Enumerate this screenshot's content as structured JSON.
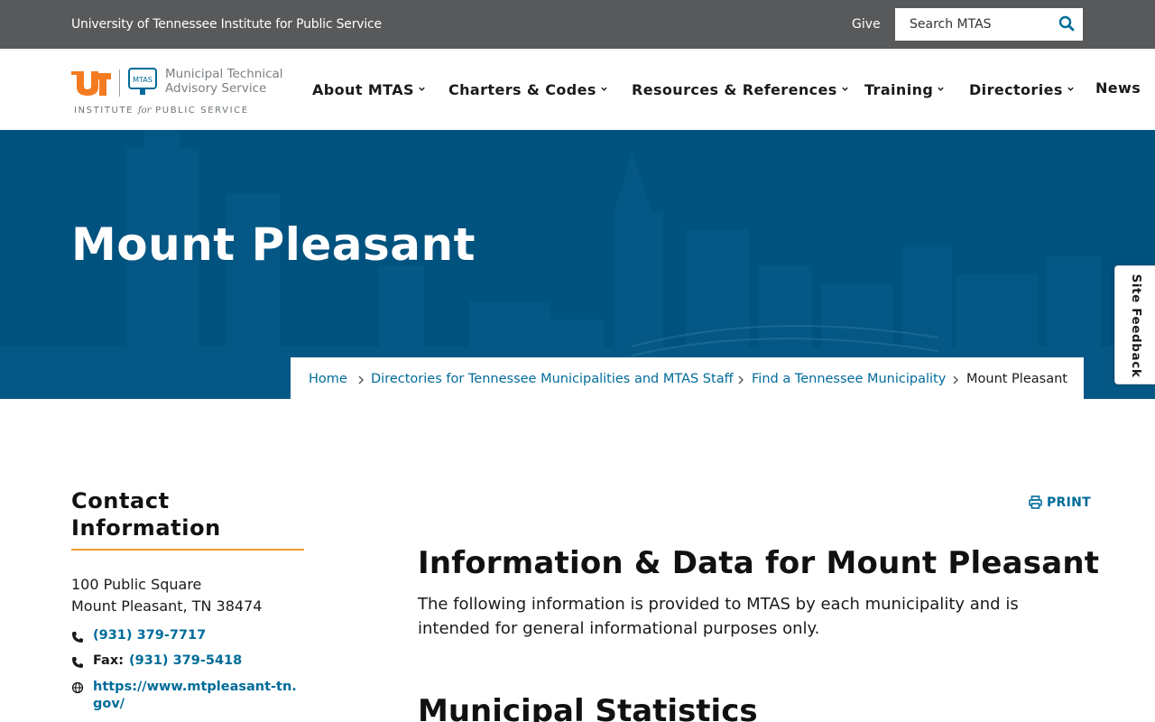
{
  "topbar": {
    "institute": "University of Tennessee Institute for Public Service",
    "give_label": "Give",
    "search_placeholder": "Search MTAS",
    "search_icon": "magnifier-icon"
  },
  "logo": {
    "ut_mark": "UT",
    "shield_text": "MTAS",
    "name_line1": "Municipal Technical",
    "name_line2": "Advisory Service",
    "tagline_pre": "INSTITUTE ",
    "tagline_for": "for",
    "tagline_post": " PUBLIC SERVICE",
    "colors": {
      "ut_orange": "#f47b20",
      "gray": "#7a8085",
      "blue": "#006c9a"
    }
  },
  "nav": {
    "items": [
      {
        "label": "About MTAS",
        "has_dropdown": true
      },
      {
        "label": "Charters & Codes",
        "has_dropdown": true
      },
      {
        "label": "Resources & References",
        "has_dropdown": true
      },
      {
        "label": "Training",
        "has_dropdown": true
      },
      {
        "label": "Directories",
        "has_dropdown": true
      },
      {
        "label": "News",
        "has_dropdown": false
      }
    ]
  },
  "hero": {
    "title": "Mount Pleasant",
    "background_color": "#00527f"
  },
  "breadcrumb": [
    {
      "label": "Home",
      "link": true
    },
    {
      "label": "Directories for Tennessee Municipalities and MTAS Staff",
      "link": true
    },
    {
      "label": "Find a Tennessee Municipality",
      "link": true
    },
    {
      "label": "Mount Pleasant",
      "link": false
    }
  ],
  "feedback": {
    "label": "Site Feedback"
  },
  "contact": {
    "heading": "Contact Information",
    "address_line1": "100 Public Square",
    "address_line2": "Mount Pleasant, TN 38474",
    "phone": "(931) 379-7717",
    "fax_label": "Fax:",
    "fax": "(931) 379-5418",
    "website": "https://www.mtpleasant-tn.gov/"
  },
  "content": {
    "print_label": "PRINT",
    "heading": "Information & Data for Mount Pleasant",
    "intro": "The following information is provided to MTAS by each municipality and is intended for general informational purposes only.",
    "stats_heading": "Municipal Statistics"
  },
  "colors": {
    "accent_link": "#006c9a",
    "accent_underline": "#f39a2b",
    "topbar_bg": "#58595b"
  }
}
